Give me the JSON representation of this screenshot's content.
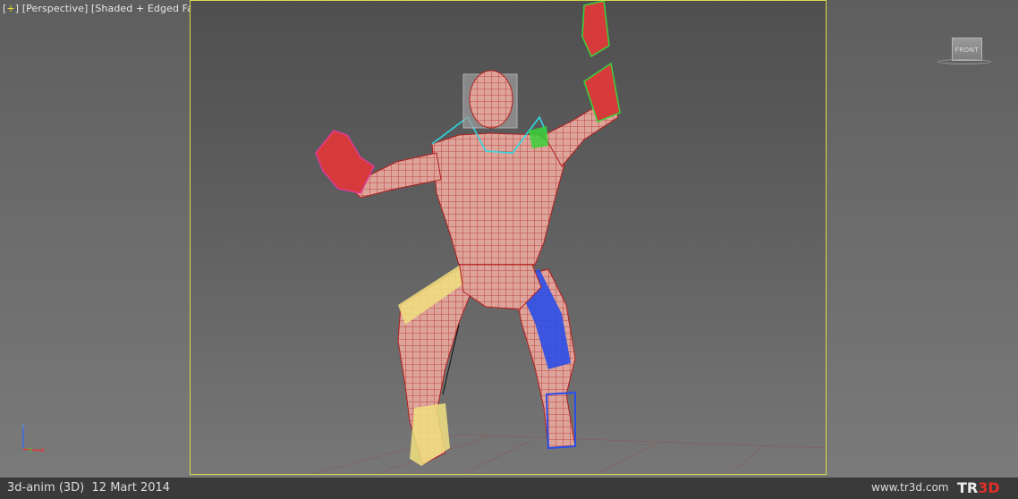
{
  "viewport": {
    "plus": "+",
    "view": "Perspective",
    "mode": "Shaded + Edged Faces"
  },
  "viewcube": {
    "face": "FRONT"
  },
  "axis": {
    "z": "z",
    "y": "y",
    "x": "x"
  },
  "status": {
    "title": "3d-anim (3D)",
    "date": "12 Mart 2014",
    "url": "www.tr3d.com"
  },
  "logo": {
    "t": "T",
    "r": "R",
    "d": "3D"
  },
  "colors": {
    "mesh": "#c83030",
    "selection_yellow": "#f0e060",
    "left_leg_blue": "#2a4ee8",
    "left_arm_green": "#3ad23a",
    "right_arm_magenta": "#e03a9a",
    "spine_cyan": "#30d8e0"
  }
}
